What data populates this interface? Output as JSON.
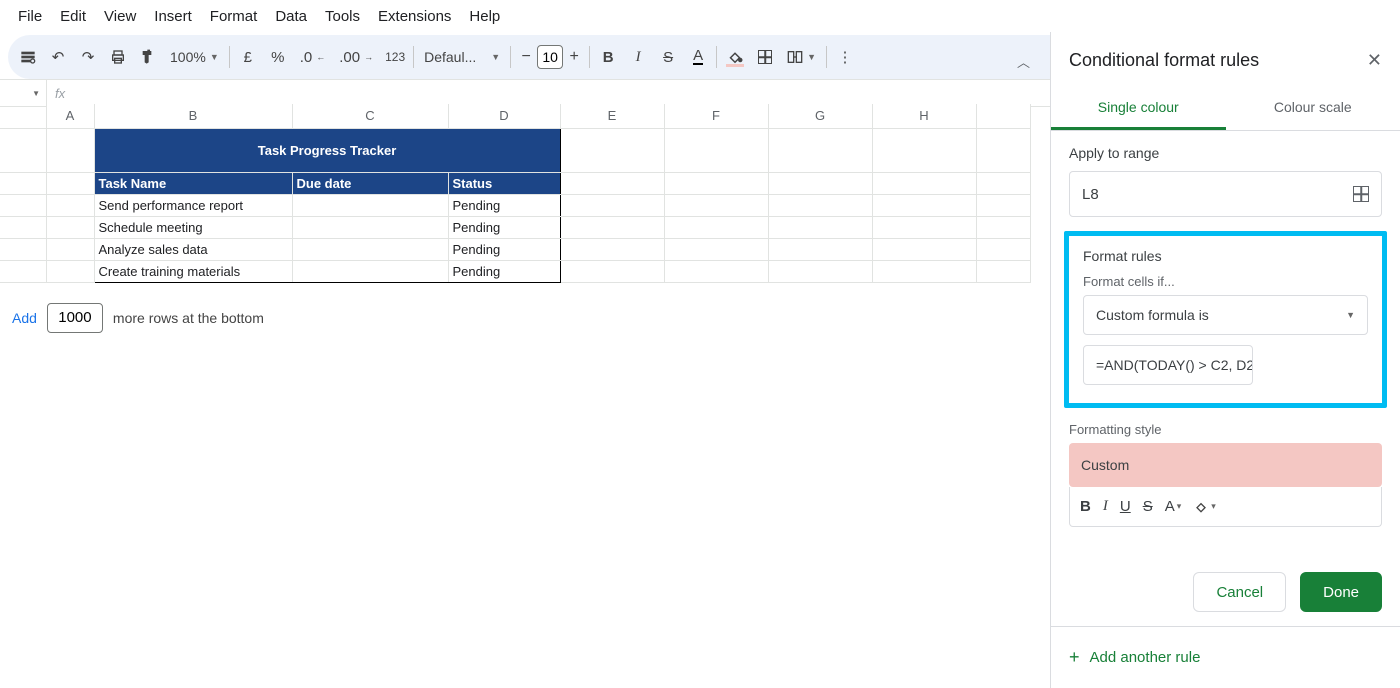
{
  "menu": [
    "File",
    "Edit",
    "View",
    "Insert",
    "Format",
    "Data",
    "Tools",
    "Extensions",
    "Help"
  ],
  "toolbar": {
    "zoom": "100%",
    "currency": "£",
    "percent": "%",
    "dec_dec": ".0",
    "inc_dec": ".00",
    "num123": "123",
    "font_name": "Defaul...",
    "font_size": "10",
    "bold": "B",
    "italic": "I",
    "strike": "S",
    "textA": "A"
  },
  "formula_bar": {
    "name": "",
    "fx": "fx"
  },
  "columns": [
    "A",
    "B",
    "C",
    "D",
    "E",
    "F",
    "G",
    "H"
  ],
  "sheet": {
    "title": "Task Progress Tracker",
    "headers": [
      "Task Name",
      "Due date",
      "Status"
    ],
    "rows": [
      {
        "task": "Send performance report",
        "due": "",
        "status": "Pending"
      },
      {
        "task": "Schedule meeting",
        "due": "",
        "status": "Pending"
      },
      {
        "task": "Analyze sales data",
        "due": "",
        "status": "Pending"
      },
      {
        "task": "Create training materials",
        "due": "",
        "status": "Pending"
      }
    ]
  },
  "addrow": {
    "button": "Add",
    "count": "1000",
    "suffix": "more rows at the bottom"
  },
  "sidebar": {
    "title": "Conditional format rules",
    "tab_single": "Single colour",
    "tab_scale": "Colour scale",
    "apply_label": "Apply to range",
    "range": "L8",
    "rules_label": "Format rules",
    "cells_if": "Format cells if...",
    "condition": "Custom formula is",
    "formula": "=AND(TODAY() > C2, D2",
    "style_label": "Formatting style",
    "style_name": "Custom",
    "cancel": "Cancel",
    "done": "Done",
    "add_rule": "Add another rule"
  }
}
